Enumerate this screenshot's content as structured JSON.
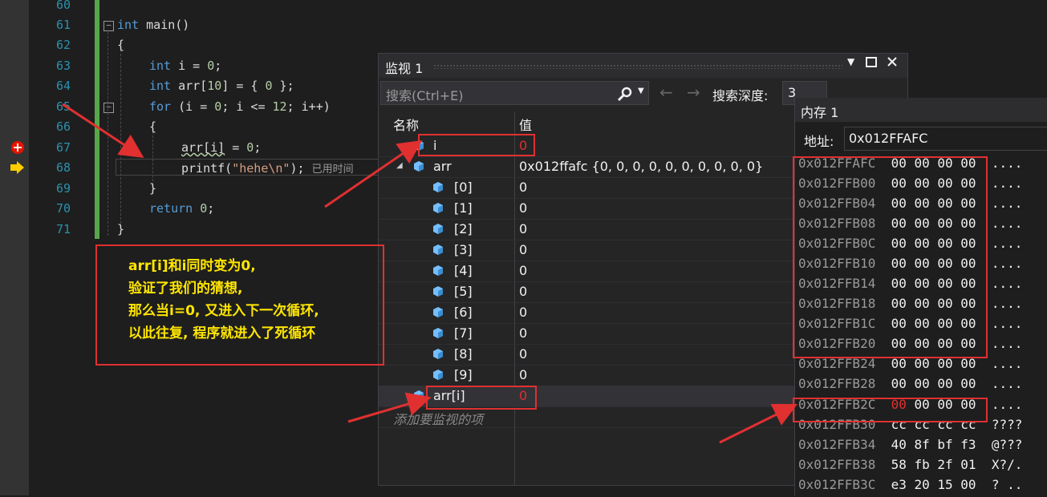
{
  "editor": {
    "lines": [
      {
        "n": "60",
        "text": ""
      },
      {
        "n": "61",
        "text": "int main()"
      },
      {
        "n": "62",
        "text": "{"
      },
      {
        "n": "63",
        "text": "int i = 0;"
      },
      {
        "n": "64",
        "text": "int arr[10] = { 0 };"
      },
      {
        "n": "65",
        "text": "for (i = 0; i <= 12; i++)"
      },
      {
        "n": "66",
        "text": "{"
      },
      {
        "n": "67",
        "text": "arr[i] = 0;"
      },
      {
        "n": "68",
        "text": "printf(\"hehe\\n\");"
      },
      {
        "n": "69",
        "text": "}"
      },
      {
        "n": "70",
        "text": "return 0;"
      },
      {
        "n": "71",
        "text": "}"
      }
    ],
    "elapsed_hint": "已用时间",
    "colors": {
      "keyword": "#569cd6",
      "number": "#b5cea8",
      "string": "#d69d85",
      "line_number": "#2b91af"
    }
  },
  "watch": {
    "title": "监视 1",
    "search_placeholder": "搜索(Ctrl+E)",
    "search_depth_label": "搜索深度:",
    "search_depth_value": "3",
    "col_name": "名称",
    "col_value": "值",
    "rows": [
      {
        "name": "i",
        "value": "0",
        "changed": true
      },
      {
        "name": "arr",
        "value": "0x012ffafc {0, 0, 0, 0, 0, 0, 0, 0, 0, 0}",
        "expanded": true
      },
      {
        "name": "[0]",
        "value": "0"
      },
      {
        "name": "[1]",
        "value": "0"
      },
      {
        "name": "[2]",
        "value": "0"
      },
      {
        "name": "[3]",
        "value": "0"
      },
      {
        "name": "[4]",
        "value": "0"
      },
      {
        "name": "[5]",
        "value": "0"
      },
      {
        "name": "[6]",
        "value": "0"
      },
      {
        "name": "[7]",
        "value": "0"
      },
      {
        "name": "[8]",
        "value": "0"
      },
      {
        "name": "[9]",
        "value": "0"
      },
      {
        "name": "arr[i]",
        "value": "0",
        "changed": true
      }
    ],
    "add_item_placeholder": "添加要监视的项"
  },
  "memory": {
    "title": "内存 1",
    "address_label": "地址:",
    "address_value": "0x012FFAFC",
    "rows": [
      {
        "addr": "0x012FFAFC",
        "bytes": "00 00 00 00",
        "chars": "...."
      },
      {
        "addr": "0x012FFB00",
        "bytes": "00 00 00 00",
        "chars": "...."
      },
      {
        "addr": "0x012FFB04",
        "bytes": "00 00 00 00",
        "chars": "...."
      },
      {
        "addr": "0x012FFB08",
        "bytes": "00 00 00 00",
        "chars": "...."
      },
      {
        "addr": "0x012FFB0C",
        "bytes": "00 00 00 00",
        "chars": "...."
      },
      {
        "addr": "0x012FFB10",
        "bytes": "00 00 00 00",
        "chars": "...."
      },
      {
        "addr": "0x012FFB14",
        "bytes": "00 00 00 00",
        "chars": "...."
      },
      {
        "addr": "0x012FFB18",
        "bytes": "00 00 00 00",
        "chars": "...."
      },
      {
        "addr": "0x012FFB1C",
        "bytes": "00 00 00 00",
        "chars": "...."
      },
      {
        "addr": "0x012FFB20",
        "bytes": "00 00 00 00",
        "chars": "...."
      },
      {
        "addr": "0x012FFB24",
        "bytes": "00 00 00 00",
        "chars": "...."
      },
      {
        "addr": "0x012FFB28",
        "bytes": "00 00 00 00",
        "chars": "...."
      },
      {
        "addr": "0x012FFB2C",
        "bytes": "00 00 00 00",
        "chars": "....",
        "first_changed": true
      },
      {
        "addr": "0x012FFB30",
        "bytes": "cc cc cc cc",
        "chars": "????"
      },
      {
        "addr": "0x012FFB34",
        "bytes": "40 8f bf f3",
        "chars": "@???"
      },
      {
        "addr": "0x012FFB38",
        "bytes": "58 fb 2f 01",
        "chars": "X?/."
      },
      {
        "addr": "0x012FFB3C",
        "bytes": "e3 20 15 00",
        "chars": "? .."
      }
    ],
    "changed_color": "#e03030"
  },
  "annotation": {
    "lines": [
      "arr[i]和i同时变为0,",
      "验证了我们的猜想,",
      "那么当i=0, 又进入下一次循环,",
      "以此往复, 程序就进入了死循环"
    ],
    "text_color": "#ffe600",
    "border_color": "#e03030"
  }
}
